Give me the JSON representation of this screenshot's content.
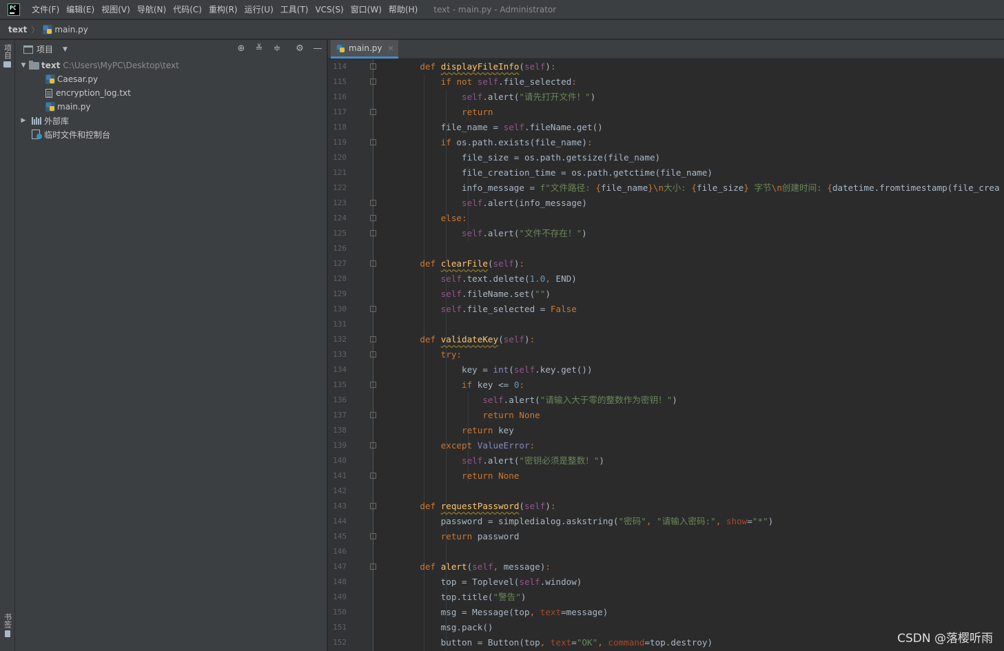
{
  "app": {
    "logo_text": "PC",
    "menu": [
      "文件(F)",
      "编辑(E)",
      "视图(V)",
      "导航(N)",
      "代码(C)",
      "重构(R)",
      "运行(U)",
      "工具(T)",
      "VCS(S)",
      "窗口(W)",
      "帮助(H)"
    ],
    "window_title": "text - main.py - Administrator"
  },
  "breadcrumb": {
    "project": "text",
    "file": "main.py"
  },
  "tool_strip": {
    "project_tab": "项目",
    "bookmarks_tab": "书签"
  },
  "project_panel": {
    "title": "项目",
    "header_icons": [
      "locate-icon",
      "expand-all-icon",
      "collapse-all-icon",
      "gear-icon",
      "hide-icon"
    ],
    "tree": {
      "root": {
        "name": "text",
        "path": "C:\\Users\\MyPC\\Desktop\\text"
      },
      "files": [
        "Caesar.py",
        "encryption_log.txt",
        "main.py"
      ],
      "external_libs": "外部库",
      "scratches": "临时文件和控制台"
    }
  },
  "editor": {
    "active_tab": "main.py",
    "first_line": 114,
    "lines": [
      {
        "n": "114",
        "t": "    def displayFileInfo(self):"
      },
      {
        "n": "115",
        "t": "        if not self.file_selected:"
      },
      {
        "n": "116",
        "t": "            self.alert(\"请先打开文件！\")"
      },
      {
        "n": "117",
        "t": "            return"
      },
      {
        "n": "118",
        "t": "        file_name = self.fileName.get()"
      },
      {
        "n": "119",
        "t": "        if os.path.exists(file_name):"
      },
      {
        "n": "120",
        "t": "            file_size = os.path.getsize(file_name)"
      },
      {
        "n": "121",
        "t": "            file_creation_time = os.path.getctime(file_name)"
      },
      {
        "n": "122",
        "t": "            info_message = f\"文件路径: {file_name}\\n大小: {file_size} 字节\\n创建时间: {datetime.fromtimestamp(file_crea"
      },
      {
        "n": "123",
        "t": "            self.alert(info_message)"
      },
      {
        "n": "124",
        "t": "        else:"
      },
      {
        "n": "125",
        "t": "            self.alert(\"文件不存在！\")"
      },
      {
        "n": "126",
        "t": ""
      },
      {
        "n": "127",
        "t": "    def clearFile(self):"
      },
      {
        "n": "128",
        "t": "        self.text.delete(1.0, END)"
      },
      {
        "n": "129",
        "t": "        self.fileName.set(\"\")"
      },
      {
        "n": "130",
        "t": "        self.file_selected = False"
      },
      {
        "n": "131",
        "t": ""
      },
      {
        "n": "132",
        "t": "    def validateKey(self):"
      },
      {
        "n": "133",
        "t": "        try:"
      },
      {
        "n": "134",
        "t": "            key = int(self.key.get())"
      },
      {
        "n": "135",
        "t": "            if key <= 0:"
      },
      {
        "n": "136",
        "t": "                self.alert(\"请输入大于零的整数作为密钥！\")"
      },
      {
        "n": "137",
        "t": "                return None"
      },
      {
        "n": "138",
        "t": "            return key"
      },
      {
        "n": "139",
        "t": "        except ValueError:"
      },
      {
        "n": "140",
        "t": "            self.alert(\"密钥必须是整数！\")"
      },
      {
        "n": "141",
        "t": "            return None"
      },
      {
        "n": "142",
        "t": ""
      },
      {
        "n": "143",
        "t": "    def requestPassword(self):"
      },
      {
        "n": "144",
        "t": "        password = simpledialog.askstring(\"密码\", \"请输入密码:\", show=\"*\")"
      },
      {
        "n": "145",
        "t": "        return password"
      },
      {
        "n": "146",
        "t": ""
      },
      {
        "n": "147",
        "t": "    def alert(self, message):"
      },
      {
        "n": "148",
        "t": "        top = Toplevel(self.window)"
      },
      {
        "n": "149",
        "t": "        top.title(\"警告\")"
      },
      {
        "n": "150",
        "t": "        msg = Message(top, text=message)"
      },
      {
        "n": "151",
        "t": "        msg.pack()"
      },
      {
        "n": "152",
        "t": "        button = Button(top, text=\"OK\", command=top.destroy)"
      }
    ]
  },
  "watermark": "CSDN @落樱听雨",
  "colors": {
    "keyword": "#cc7832",
    "self": "#94558d",
    "function": "#ffc66d",
    "string": "#6a8759",
    "number": "#6897bb",
    "param": "#aa4926",
    "builtin": "#8888c6",
    "default_text": "#a9b7c6",
    "background": "#2b2b2b",
    "panel": "#3c3f41"
  }
}
